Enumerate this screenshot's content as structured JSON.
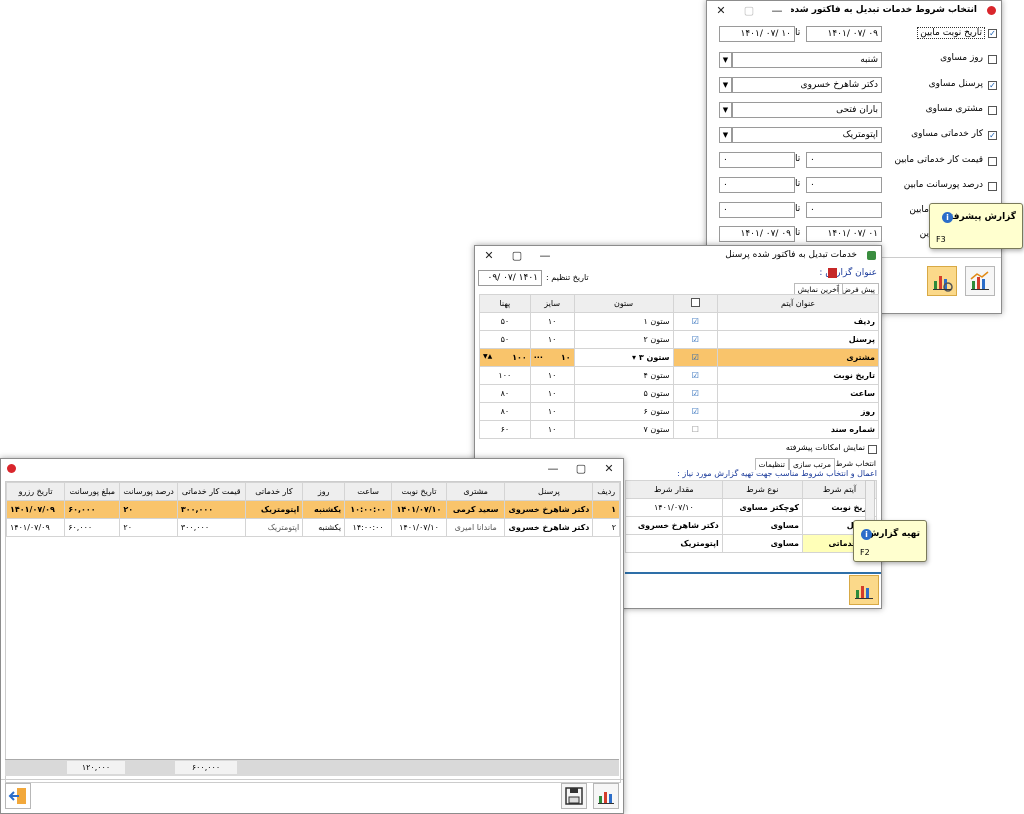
{
  "filter_dialog": {
    "title": "انتخاب شروط خدمات تبدیل به فاکتور شده پرسنل",
    "rows": [
      {
        "label": "تاریخ نوبت مابین",
        "checked": true,
        "from": "۰۹ /۰۷ /۱۴۰۱",
        "to": "۱۰ /۰۷ /۱۴۰۱",
        "sep": "تا"
      },
      {
        "label": "روز مساوی",
        "checked": false,
        "value": "شنبه"
      },
      {
        "label": "پرسنل مساوی",
        "checked": true,
        "value": "دکتر شاهرخ خسروی"
      },
      {
        "label": "مشتری مساوی",
        "checked": false,
        "value": "باران فتحی"
      },
      {
        "label": "کار خدماتی مساوی",
        "checked": true,
        "value": "اپتومتریک"
      },
      {
        "label": "قیمت کار خدماتی مابین",
        "checked": false,
        "from": "۰",
        "to": "۰",
        "sep": "تا"
      },
      {
        "label": "درصد پورسانت مابین",
        "checked": false,
        "from": "۰",
        "to": "۰",
        "sep": "تا"
      },
      {
        "label": "مابین",
        "checked": false,
        "from": "۰",
        "to": "۰",
        "sep": "تا"
      },
      {
        "label": "ین",
        "checked": false,
        "from": "۰۱ /۰۷ /۱۴۰۱",
        "to": "۰۹ /۰۷ /۱۴۰۱",
        "sep": "تا"
      }
    ],
    "tooltip": {
      "title": "گزارش پیشرفته",
      "key": "F3"
    }
  },
  "settings_dialog": {
    "title": "خدمات تبدیل به فاکتور شده پرسنل",
    "report_title_label": "عنوان گزارش :",
    "date_label": "تاریخ تنظیم :",
    "date_value": "۱۴۰۱ /۰۷ /۰۹",
    "tabs": [
      "پیش فرض",
      "آخرین نمایش"
    ],
    "columns": [
      "عنوان آیتم",
      "",
      "ستون",
      "سایز",
      "پهنا"
    ],
    "rows": [
      {
        "item": "ردیف",
        "checked": true,
        "col": "ستون ۱",
        "size": "۱۰",
        "width": "۵۰"
      },
      {
        "item": "پرسنل",
        "checked": true,
        "col": "ستون ۲",
        "size": "۱۰",
        "width": "۵۰"
      },
      {
        "item": "مشتری",
        "checked": true,
        "col": "ستون ۳",
        "size": "۱۰",
        "width": "۱۰۰"
      },
      {
        "item": "تاریخ نوبت",
        "checked": true,
        "col": "ستون ۴",
        "size": "۱۰",
        "width": "۱۰۰"
      },
      {
        "item": "ساعت",
        "checked": true,
        "col": "ستون ۵",
        "size": "۱۰",
        "width": "۸۰"
      },
      {
        "item": "روز",
        "checked": true,
        "col": "ستون ۶",
        "size": "۱۰",
        "width": "۸۰"
      },
      {
        "item": "شماره سند",
        "checked": false,
        "col": "ستون ۷",
        "size": "۱۰",
        "width": "۶۰"
      }
    ],
    "advanced_label": "نمایش امکانات پیشرفته",
    "lower_tabs": [
      "انتخاب شرط",
      "مرتب سازی",
      "تنظیمات"
    ],
    "hint": "اعمال و انتخاب شروط مناسب جهت تهیه گزارش مورد نیاز :",
    "cond_columns": [
      "آیتم شرط",
      "نوع شرط",
      "مقدار شرط"
    ],
    "conditions": [
      {
        "item": "تاریخ نوبت",
        "type": "کوچکتر مساوی",
        "value": "۱۴۰۱/۰۷/۱۰"
      },
      {
        "item": "پرسنل",
        "type": "مساوی",
        "value": "دکتر شاهرخ خسروی"
      },
      {
        "item": "کار خدماتی",
        "type": "مساوی",
        "value": "اپتومتریک"
      }
    ],
    "tooltip": {
      "title": "تهیه گزارش",
      "key": "F2"
    }
  },
  "report_window": {
    "columns": [
      "ردیف",
      "پرسنل",
      "مشتری",
      "تاریخ نوبت",
      "ساعت",
      "روز",
      "کار خدماتی",
      "قیمت کار خدماتی",
      "درصد پورسانت",
      "مبلغ پورسانت",
      "تاریخ رزرو"
    ],
    "rows": [
      [
        "۱",
        "دکتر شاهرخ خسروی",
        "سعید کرمی",
        "۱۴۰۱/۰۷/۱۰",
        "۱۰:۰۰:۰۰",
        "یکشنبه",
        "اپتومتریک",
        "۳۰۰,۰۰۰",
        "۲۰",
        "۶۰,۰۰۰",
        "۱۴۰۱/۰۷/۰۹"
      ],
      [
        "۲",
        "دکتر شاهرخ خسروی",
        "ماندانا امیری",
        "۱۴۰۱/۰۷/۱۰",
        "۱۴:۰۰:۰۰",
        "یکشنبه",
        "اپتومتریک",
        "۳۰۰,۰۰۰",
        "۲۰",
        "۶۰,۰۰۰",
        "۱۴۰۱/۰۷/۰۹"
      ]
    ],
    "total_commission": "۱۲۰,۰۰۰",
    "total_price": "۶۰۰,۰۰۰"
  },
  "colors": {
    "highlight": "#f9c46b",
    "tooltip": "#ffffcf",
    "accent": "#2b6dc9",
    "app_icon": "#d9262c"
  }
}
